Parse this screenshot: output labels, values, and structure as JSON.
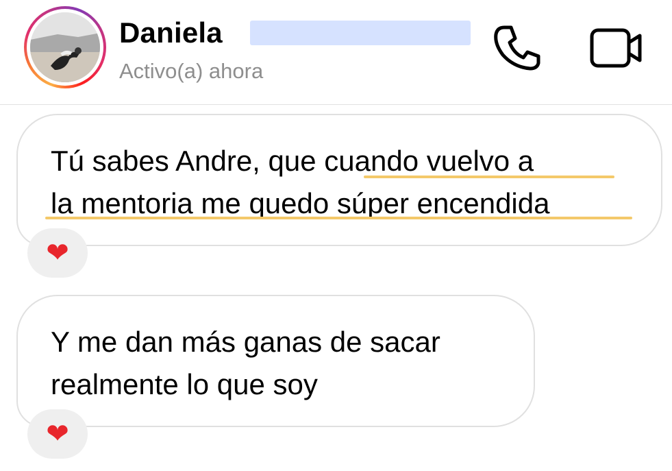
{
  "header": {
    "contact_name": "Daniela",
    "status": "Activo(a) ahora",
    "icons": {
      "call": "phone-icon",
      "video": "video-camera-icon"
    }
  },
  "messages": [
    {
      "text": "Tú sabes Andre, que cuando vuelvo a\nla mentoria me quedo súper encendida",
      "reaction": "❤"
    },
    {
      "text": "Y me dan más ganas de sacar\nrealmente lo que soy",
      "reaction": "❤"
    }
  ],
  "colors": {
    "status_text": "#8e8e8e",
    "bubble_border": "#e0e0e0",
    "highlight_underline": "#f4c96a",
    "reaction_bg": "#efefef",
    "heart": "#e8262c"
  }
}
